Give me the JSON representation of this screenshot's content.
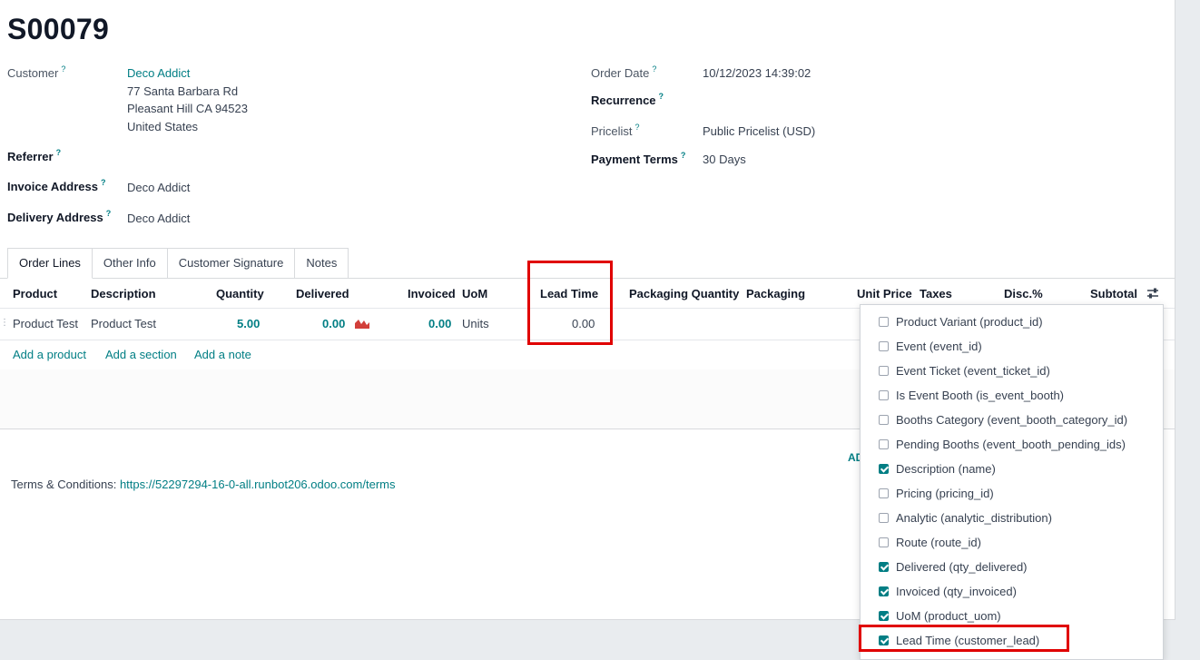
{
  "order": {
    "title": "S00079"
  },
  "fields": {
    "customer_label": "Customer",
    "customer_name": "Deco Addict",
    "customer_addr1": "77 Santa Barbara Rd",
    "customer_addr2": "Pleasant Hill CA 94523",
    "customer_addr3": "United States",
    "referrer_label": "Referrer",
    "invoice_label": "Invoice Address",
    "invoice_value": "Deco Addict",
    "delivery_label": "Delivery Address",
    "delivery_value": "Deco Addict",
    "order_date_label": "Order Date",
    "order_date_value": "10/12/2023 14:39:02",
    "recurrence_label": "Recurrence",
    "pricelist_label": "Pricelist",
    "pricelist_value": "Public Pricelist (USD)",
    "payment_label": "Payment Terms",
    "payment_value": "30 Days",
    "help_mark": "?"
  },
  "tabs": [
    "Order Lines",
    "Other Info",
    "Customer Signature",
    "Notes"
  ],
  "table": {
    "headers": [
      "Product",
      "Description",
      "Quantity",
      "Delivered",
      "Invoiced",
      "UoM",
      "Lead Time",
      "Packaging Quantity",
      "Packaging",
      "Unit Price",
      "Taxes",
      "Disc.%",
      "Subtotal"
    ],
    "row": {
      "product": "Product Test",
      "description": "Product Test",
      "quantity": "5.00",
      "delivered": "0.00",
      "invoiced": "0.00",
      "uom": "Units",
      "lead_time": "0.00"
    },
    "add_product": "Add a product",
    "add_section": "Add a section",
    "add_note": "Add a note"
  },
  "truncated_text": "AD",
  "terms": {
    "label": "Terms & Conditions:",
    "url": "https://52297294-16-0-all.runbot206.odoo.com/terms"
  },
  "optional_columns": [
    {
      "label": "Product Variant (product_id)",
      "checked": false
    },
    {
      "label": "Event (event_id)",
      "checked": false
    },
    {
      "label": "Event Ticket (event_ticket_id)",
      "checked": false
    },
    {
      "label": "Is Event Booth (is_event_booth)",
      "checked": false
    },
    {
      "label": "Booths Category (event_booth_category_id)",
      "checked": false
    },
    {
      "label": "Pending Booths (event_booth_pending_ids)",
      "checked": false
    },
    {
      "label": "Description (name)",
      "checked": true
    },
    {
      "label": "Pricing (pricing_id)",
      "checked": false
    },
    {
      "label": "Analytic (analytic_distribution)",
      "checked": false
    },
    {
      "label": "Route (route_id)",
      "checked": false
    },
    {
      "label": "Delivered (qty_delivered)",
      "checked": true
    },
    {
      "label": "Invoiced (qty_invoiced)",
      "checked": true
    },
    {
      "label": "UoM (product_uom)",
      "checked": true
    },
    {
      "label": "Lead Time (customer_lead)",
      "checked": true
    }
  ],
  "colors": {
    "accent": "#017e84",
    "highlight": "#e00000"
  }
}
